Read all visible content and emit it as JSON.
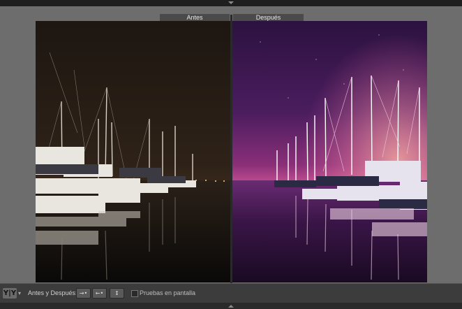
{
  "view": {
    "before_label": "Antes",
    "after_label": "Después"
  },
  "toolbar": {
    "view_mode_icon": "yy-icon",
    "view_mode_text": "Y|Y",
    "before_after_label": "Antes y Después:",
    "swap_buttons": [
      "→•",
      "←•",
      "↕"
    ],
    "soft_proofing_label": "Pruebas en pantalla",
    "soft_proofing_checked": false
  },
  "colors": {
    "before_sky": "#2b1f17",
    "after_sky_top": "#2a0f3b",
    "after_sky_glow": "#e05aa0"
  }
}
